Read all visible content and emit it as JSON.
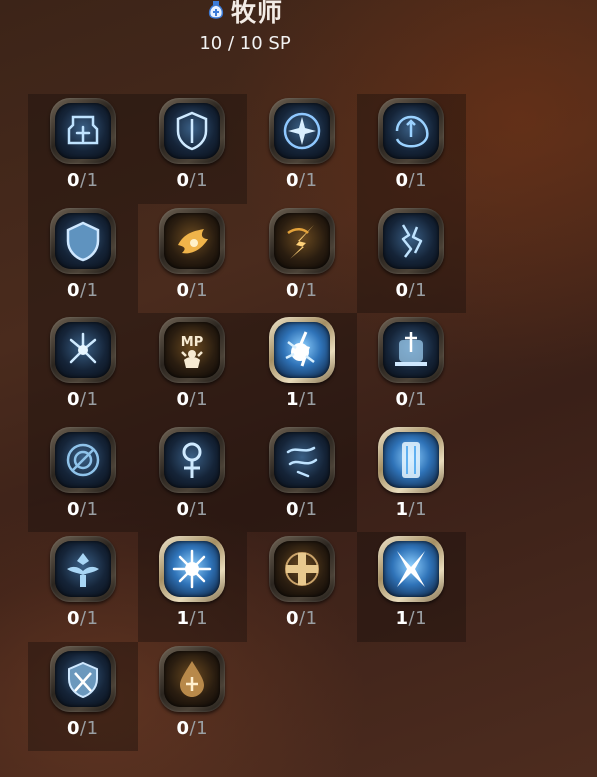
{
  "header": {
    "class_name": "牧师",
    "class_icon": "priest-class-icon",
    "sp_used": "10",
    "sp_separator": "/",
    "sp_total": "10",
    "sp_unit": "SP"
  },
  "skill_separator": "/",
  "skills": [
    {
      "icon": "guardian-armor-icon",
      "level": "0",
      "max": "1"
    },
    {
      "icon": "shield-icon",
      "level": "0",
      "max": "1"
    },
    {
      "icon": "compass-star-icon",
      "level": "0",
      "max": "1"
    },
    {
      "icon": "vortex-shield-icon",
      "level": "0",
      "max": "1"
    },
    {
      "icon": "round-shield-icon",
      "level": "0",
      "max": "1"
    },
    {
      "icon": "golden-dove-icon",
      "level": "0",
      "max": "1"
    },
    {
      "icon": "golden-strike-icon",
      "level": "0",
      "max": "1"
    },
    {
      "icon": "lightning-storm-icon",
      "level": "0",
      "max": "1"
    },
    {
      "icon": "spark-burst-icon",
      "level": "0",
      "max": "1"
    },
    {
      "icon": "mp-restore-icon",
      "level": "0",
      "max": "1",
      "text": "MP"
    },
    {
      "icon": "lightning-burst-icon",
      "level": "1",
      "max": "1"
    },
    {
      "icon": "holy-altar-icon",
      "level": "0",
      "max": "1"
    },
    {
      "icon": "sealed-circle-icon",
      "level": "0",
      "max": "1"
    },
    {
      "icon": "ankh-icon",
      "level": "0",
      "max": "1"
    },
    {
      "icon": "wind-slash-icon",
      "level": "0",
      "max": "1"
    },
    {
      "icon": "light-pillar-icon",
      "level": "1",
      "max": "1"
    },
    {
      "icon": "winged-idol-icon",
      "level": "0",
      "max": "1"
    },
    {
      "icon": "radiant-star-icon",
      "level": "1",
      "max": "1"
    },
    {
      "icon": "holy-cross-icon",
      "level": "0",
      "max": "1"
    },
    {
      "icon": "cross-slash-icon",
      "level": "1",
      "max": "1"
    },
    {
      "icon": "crossed-swords-shield-icon",
      "level": "0",
      "max": "1"
    },
    {
      "icon": "holy-water-drop-icon",
      "level": "0",
      "max": "1"
    }
  ]
}
